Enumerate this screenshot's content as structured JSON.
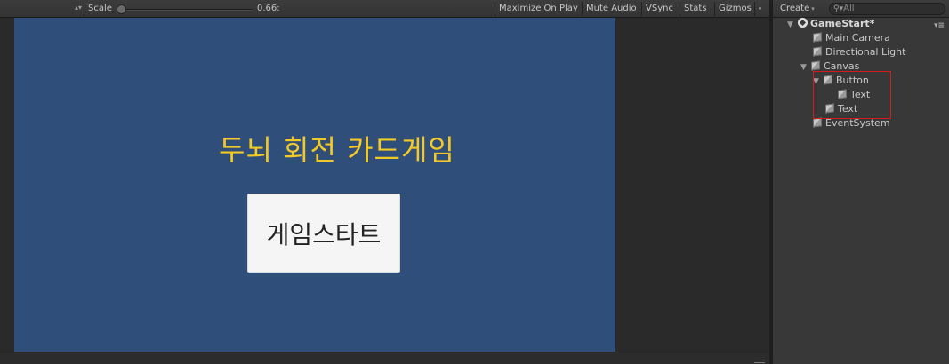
{
  "game_view": {
    "toolbar": {
      "scale_label": "Scale",
      "scale_value": "0.66:",
      "buttons": {
        "maximize": "Maximize On Play",
        "mute": "Mute Audio",
        "vsync": "VSync",
        "stats": "Stats",
        "gizmos": "Gizmos"
      }
    },
    "title_text": "두뇌 회전 카드게임",
    "start_button_label": "게임스타트",
    "colors": {
      "canvas_bg": "#2f4e7a",
      "title_color": "#f2c926",
      "button_bg": "#f5f5f5"
    }
  },
  "hierarchy": {
    "create_label": "Create",
    "search_placeholder": "All",
    "scene_name": "GameStart*",
    "items": [
      {
        "label": "Main Camera"
      },
      {
        "label": "Directional Light"
      },
      {
        "label": "Canvas"
      },
      {
        "label": "Button"
      },
      {
        "label": "Text"
      },
      {
        "label": "Text"
      },
      {
        "label": "EventSystem"
      }
    ],
    "highlight_color": "#d21b1b"
  }
}
